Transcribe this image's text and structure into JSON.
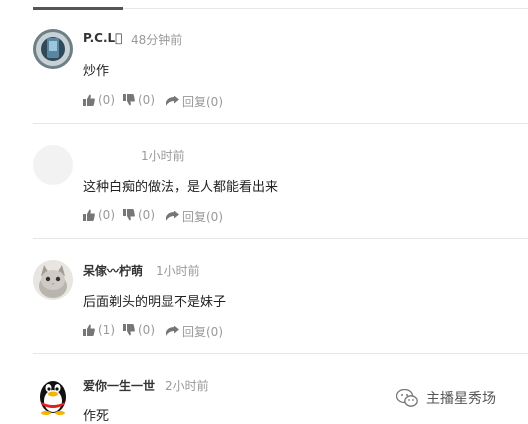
{
  "comments": [
    {
      "username": "P.C.L",
      "time": "48分钟前",
      "text": "炒作",
      "actions": {
        "like_count": "(0)",
        "dislike_count": "(0)",
        "reply_label": "回复(0)"
      }
    },
    {
      "username": "",
      "time": "1小时前",
      "text": "这种白痴的做法，是人都能看出来",
      "actions": {
        "like_count": "(0)",
        "dislike_count": "(0)",
        "reply_label": "回复(0)"
      }
    },
    {
      "username": "呆傢〰柠萌",
      "time": "1小时前",
      "text": "后面剃头的明显不是妹子",
      "actions": {
        "like_count": "(1)",
        "dislike_count": "(0)",
        "reply_label": "回复(0)"
      }
    },
    {
      "username": "爱你一生一世",
      "time": "2小时前",
      "text": "作死",
      "actions": {
        "like_count": "",
        "dislike_count": "",
        "reply_label": ""
      }
    }
  ],
  "watermark": {
    "text": "主播星秀场"
  },
  "colors": {
    "text": "#333333",
    "meta": "#999999",
    "separator": "#e6e6e6"
  }
}
